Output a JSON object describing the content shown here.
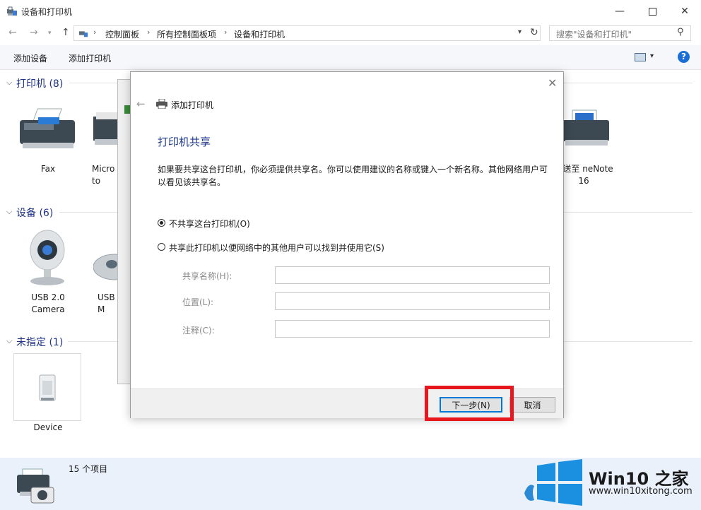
{
  "window": {
    "title": "设备和打印机"
  },
  "nav": {
    "breadcrumbs": [
      "控制面板",
      "所有控制面板项",
      "设备和打印机"
    ],
    "search_placeholder": "搜索\"设备和打印机\""
  },
  "toolbar": {
    "add_device": "添加设备",
    "add_printer": "添加打印机"
  },
  "groups": {
    "printers": {
      "title": "打印机 (8)",
      "items": [
        {
          "label": "Fax"
        },
        {
          "label": "Micro to"
        },
        {
          "label": "发送至 neNote 16"
        }
      ]
    },
    "devices": {
      "title": "设备 (6)",
      "items": [
        {
          "label": "USB 2.0 Camera"
        },
        {
          "label": "USB M"
        }
      ]
    },
    "unspecified": {
      "title": "未指定 (1)",
      "items": [
        {
          "label": "Device"
        }
      ]
    }
  },
  "status": {
    "count": "15 个项目"
  },
  "dialog": {
    "title": "添加打印机",
    "heading": "打印机共享",
    "description": "如果要共享这台打印机，你必须提供共享名。你可以使用建议的名称或键入一个新名称。其他网络用户可以看见该共享名。",
    "option_no_share": "不共享这台打印机(O)",
    "option_share": "共享此打印机以便网络中的其他用户可以找到并使用它(S)",
    "share_name_label": "共享名称(H):",
    "location_label": "位置(L):",
    "comment_label": "注释(C):",
    "next_button": "下一步(N)",
    "cancel_button": "取消"
  },
  "watermark": {
    "brand": "Win10 之家",
    "url": "www.win10xitong.com"
  },
  "colors": {
    "accent": "#0078d7",
    "highlight": "#e8161d",
    "group_title": "#1e3287"
  }
}
